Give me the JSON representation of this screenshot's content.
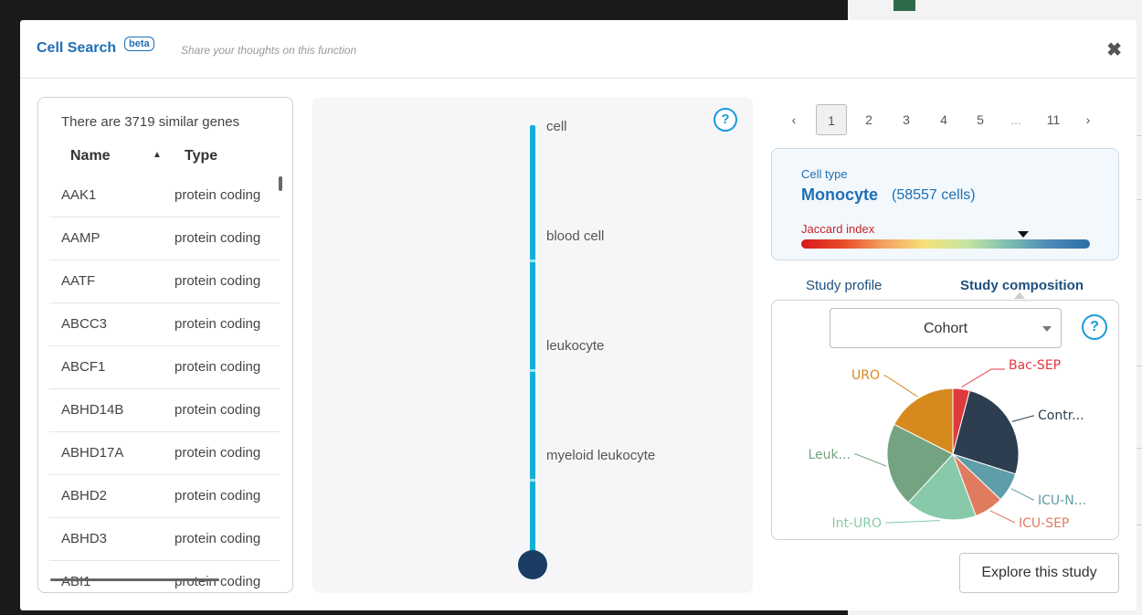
{
  "header": {
    "title": "Cell Search",
    "beta_badge": "beta",
    "feedback_link": "Share your thoughts on this function",
    "close_label": "✖"
  },
  "gene_list": {
    "count_text": "There are 3719 similar genes",
    "columns": [
      "Name",
      "Type"
    ],
    "sort_icon": "sort-ascending-icon",
    "rows": [
      {
        "name": "AAK1",
        "type": "protein coding"
      },
      {
        "name": "AAMP",
        "type": "protein coding"
      },
      {
        "name": "AATF",
        "type": "protein coding"
      },
      {
        "name": "ABCC3",
        "type": "protein coding"
      },
      {
        "name": "ABCF1",
        "type": "protein coding"
      },
      {
        "name": "ABHD14B",
        "type": "protein coding"
      },
      {
        "name": "ABHD17A",
        "type": "protein coding"
      },
      {
        "name": "ABHD2",
        "type": "protein coding"
      },
      {
        "name": "ABHD3",
        "type": "protein coding"
      },
      {
        "name": "ABI1",
        "type": "protein coding"
      }
    ]
  },
  "hierarchy": {
    "help_label": "?",
    "nodes": [
      "cell",
      "blood cell",
      "leukocyte",
      "myeloid leukocyte"
    ],
    "line_color": "#14afd8",
    "end_dot_color": "#1c3d63"
  },
  "pagination": {
    "prev": "‹",
    "pages": [
      "1",
      "2",
      "3",
      "4",
      "5",
      "...",
      "11"
    ],
    "active_page": "1",
    "next": "›"
  },
  "cell_type": {
    "label": "Cell type",
    "name": "Monocyte",
    "count": "(58557 cells)",
    "jaccard_label": "Jaccard index",
    "jaccard_value": 0.77
  },
  "tabs": {
    "profile": "Study profile",
    "composition": "Study composition",
    "active": "composition"
  },
  "composition": {
    "select_value": "Cohort",
    "help_label": "?",
    "explore_button": "Explore this study"
  },
  "chart_data": {
    "type": "pie",
    "categories": [
      "Bac-SEP",
      "Contr...",
      "ICU-N...",
      "ICU-SEP",
      "Int-URO",
      "Leuk...",
      "URO"
    ],
    "values": [
      4,
      25,
      7,
      7,
      17,
      20,
      17
    ],
    "colors": [
      "#e0393e",
      "#2c3e50",
      "#5f9ea8",
      "#e07b60",
      "#88c9a9",
      "#74a382",
      "#d68a1e"
    ],
    "title": "",
    "legend": "callout-labels"
  }
}
